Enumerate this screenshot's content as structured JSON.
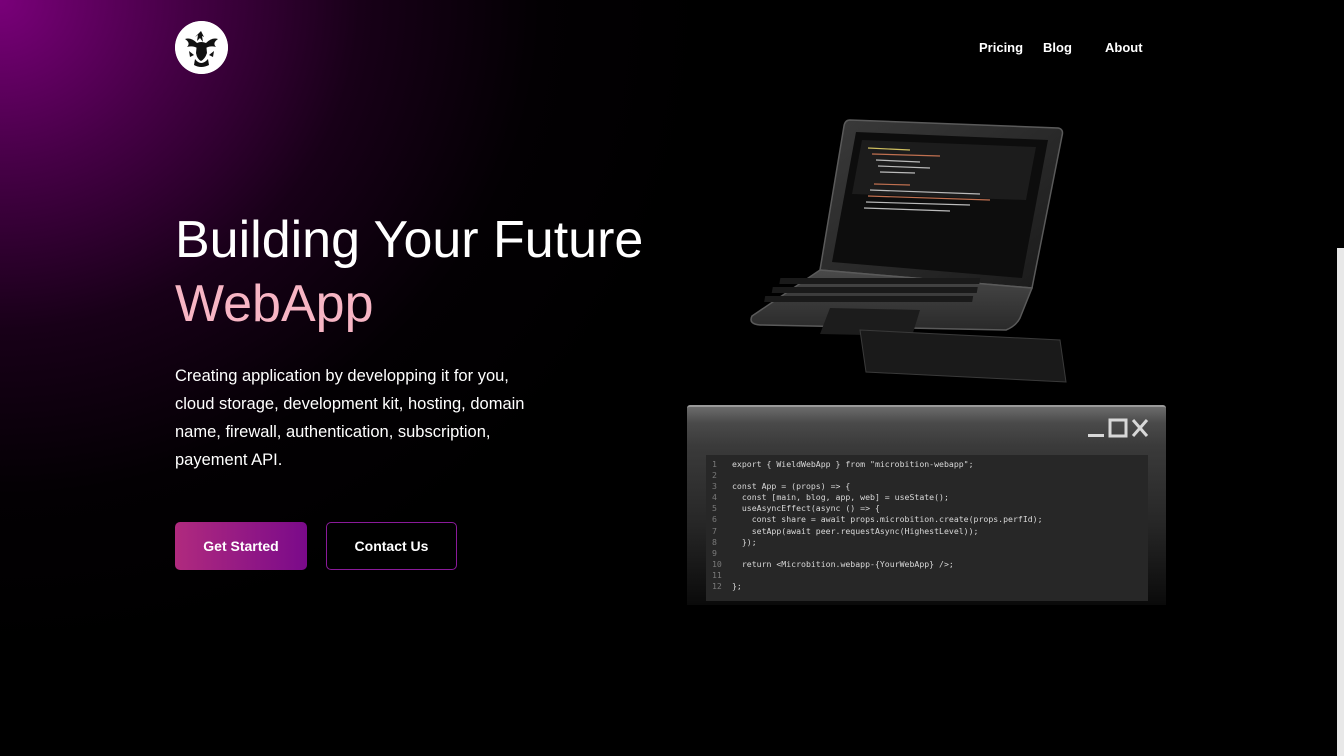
{
  "nav": {
    "logo_icon": "phoenix-logo-icon",
    "items": [
      "Pricing",
      "Blog",
      "About"
    ]
  },
  "hero": {
    "title_line1": "Building Your Future",
    "title_line2": "WebApp",
    "description": "Creating application by developping it for you, cloud storage, development kit, hosting, domain name, firewall, authentication, subscription, payement API.",
    "primary_button": "Get Started",
    "secondary_button": "Contact Us"
  },
  "code_window": {
    "controls": [
      "minimize-icon",
      "maximize-icon",
      "close-icon"
    ],
    "lines": [
      {
        "n": "1",
        "text": "export { WieldWebApp } from \"microbition-webapp\";"
      },
      {
        "n": "2",
        "text": ""
      },
      {
        "n": "3",
        "text": "const App = (props) => {"
      },
      {
        "n": "4",
        "text": "  const [main, blog, app, web] = useState();"
      },
      {
        "n": "5",
        "text": "  useAsyncEffect(async () => {"
      },
      {
        "n": "6",
        "text": "    const share = await props.microbition.create(props.perfId);"
      },
      {
        "n": "7",
        "text": "    setApp(await peer.requestAsync(HighestLevel));"
      },
      {
        "n": "8",
        "text": "  });"
      },
      {
        "n": "9",
        "text": ""
      },
      {
        "n": "10",
        "text": "  return <Microbition.webapp-{YourWebApp} />;"
      },
      {
        "n": "11",
        "text": ""
      },
      {
        "n": "12",
        "text": "};"
      }
    ]
  },
  "colors": {
    "accent_pink": "#f7b5c4",
    "button_gradient_start": "#b02a7e",
    "button_gradient_end": "#7a0a8a",
    "glow_purple": "#800080"
  }
}
